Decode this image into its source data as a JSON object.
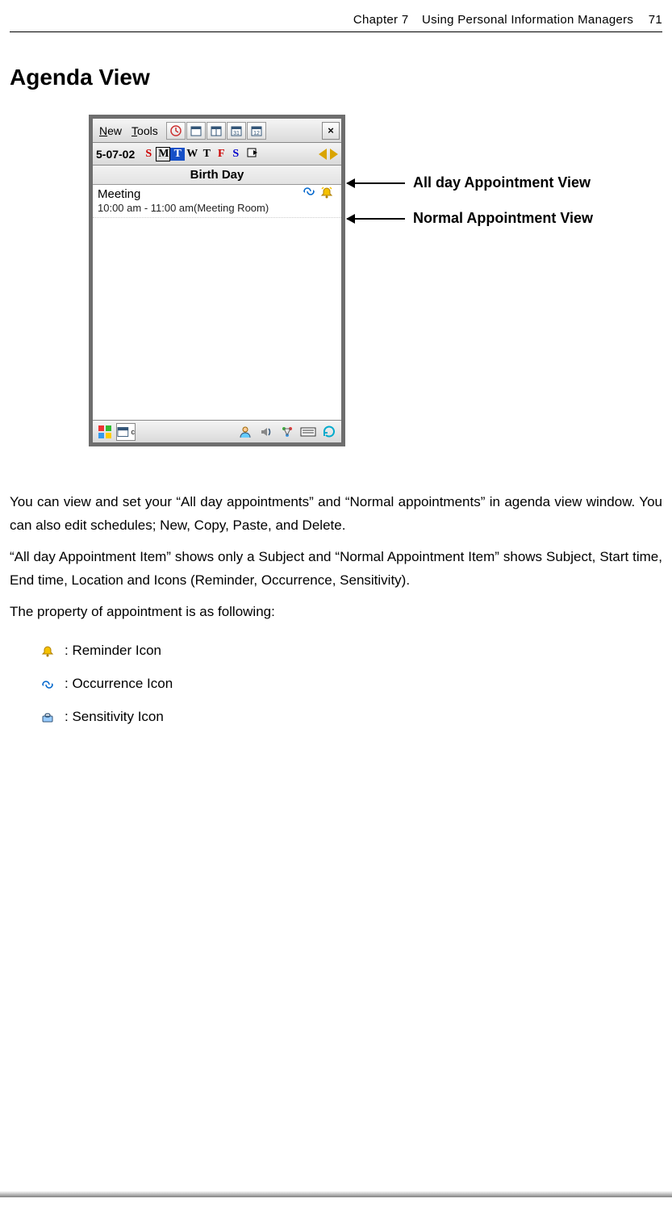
{
  "header": {
    "chapter": "Chapter 7",
    "title": "Using Personal Information Managers",
    "page_number": "71"
  },
  "section_title": "Agenda View",
  "device": {
    "menu": {
      "new": "New",
      "tools": "Tools"
    },
    "toolbar_icons": [
      "clock",
      "cal1",
      "cal2",
      "cal31",
      "cal12"
    ],
    "date": "5-07-02",
    "weekdays": [
      "S",
      "M",
      "T",
      "W",
      "T",
      "F",
      "S"
    ],
    "allday_label": "Birth Day",
    "appointment": {
      "title": "Meeting",
      "time_text": "10:00 am - 11:00 am(Meeting Room)"
    }
  },
  "callouts": {
    "allday": "All day Appointment View",
    "normal": "Normal Appointment View"
  },
  "paragraphs": {
    "p1": "You can view and set your “All day appointments” and “Normal appointments” in agenda view window. You can also edit schedules; New, Copy, Paste, and Delete.",
    "p2": "“All day Appointment Item” shows only a Subject and “Normal Appointment Item” shows Subject, Start time, End time, Location and Icons (Reminder, Occurrence, Sensitivity).",
    "p3": "The property of appointment is as following:"
  },
  "legend": {
    "reminder": ": Reminder Icon",
    "occurrence": ": Occurrence Icon",
    "sensitivity": ": Sensitivity Icon"
  }
}
